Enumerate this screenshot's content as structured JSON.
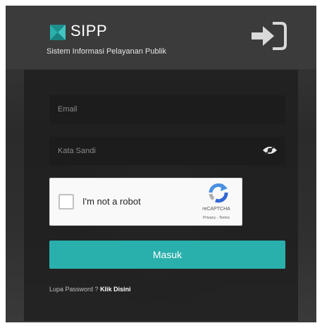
{
  "brand": {
    "title": "SIPP",
    "subtitle": "Sistem Informasi Pelayanan Publik",
    "accent": "#2ab0ac"
  },
  "header": {
    "login_icon": "sign-in-icon"
  },
  "form": {
    "email_placeholder": "Email",
    "password_placeholder": "Kata Sandi",
    "password_toggle_icon": "eye-slash-icon",
    "submit_label": "Masuk"
  },
  "recaptcha": {
    "label": "I'm not a robot",
    "brand": "reCAPTCHA",
    "links": "Privacy - Terms",
    "icon": "recaptcha-logo-icon"
  },
  "forgot": {
    "text": "Lupa Password ?",
    "link_label": "Klik Disini"
  }
}
